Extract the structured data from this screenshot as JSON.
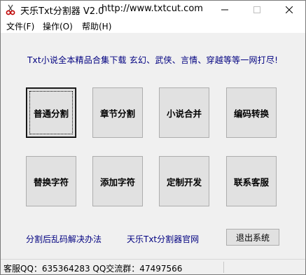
{
  "titlebar": {
    "title": "天乐Txt分割器 V2.0",
    "url": "http://www.txtcut.com",
    "icon": "scissors-icon"
  },
  "menu": {
    "file": "文件(F)",
    "operate": "操作(O)",
    "help": "帮助(H)"
  },
  "slogan": "Txt小说全本精品合集下载 玄幻、武侠、言情、穿越等等一网打尽!",
  "buttons": {
    "normal_split": "普通分割",
    "chapter_split": "章节分割",
    "novel_merge": "小说合并",
    "encoding_convert": "编码转换",
    "replace_chars": "替换字符",
    "add_chars": "添加字符",
    "custom_dev": "定制开发",
    "contact_support": "联系客服",
    "exit": "退出系统"
  },
  "links": {
    "garbled_fix": "分割后乱码解决办法",
    "official_site": "天乐Txt分割器官网"
  },
  "statusbar": {
    "text": "客服QQ：635364283  QQ交流群：47497566"
  }
}
